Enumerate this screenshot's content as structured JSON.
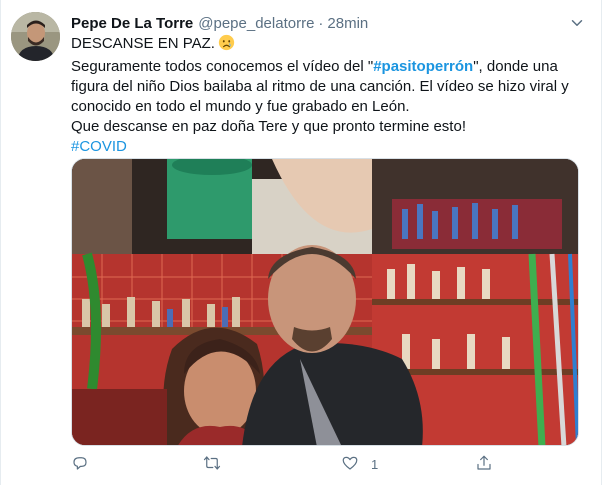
{
  "tweet": {
    "author_name": "Pepe De La Torre",
    "handle": "@pepe_delatorre",
    "separator": "·",
    "time": "28min",
    "line1": "DESCANSE EN PAZ.",
    "line2_pre": "Seguramente todos conocemos el vídeo del \"",
    "hashtag": "#pasitoperrón",
    "line2_post": "\", donde una figura del niño Dios bailaba al ritmo de una canción. El vídeo se hizo viral y conocido en todo el mundo y fue grabado en León.",
    "line3": "Que descanse en paz doña Tere y que pronto termine esto!",
    "hashtag2": "#COVID"
  },
  "icons": {
    "more": "chevron-down-icon",
    "emoji": "crying-face-emoji-icon",
    "reply": "reply-icon",
    "retweet": "retweet-icon",
    "like": "heart-icon",
    "share": "share-icon"
  },
  "actions": {
    "reply_count": "",
    "retweet_count": "",
    "like_count": "1",
    "share_count": ""
  },
  "colors": {
    "link": "#1b95e0",
    "secondary_text": "#5b7083",
    "primary_text": "#0f1419"
  }
}
